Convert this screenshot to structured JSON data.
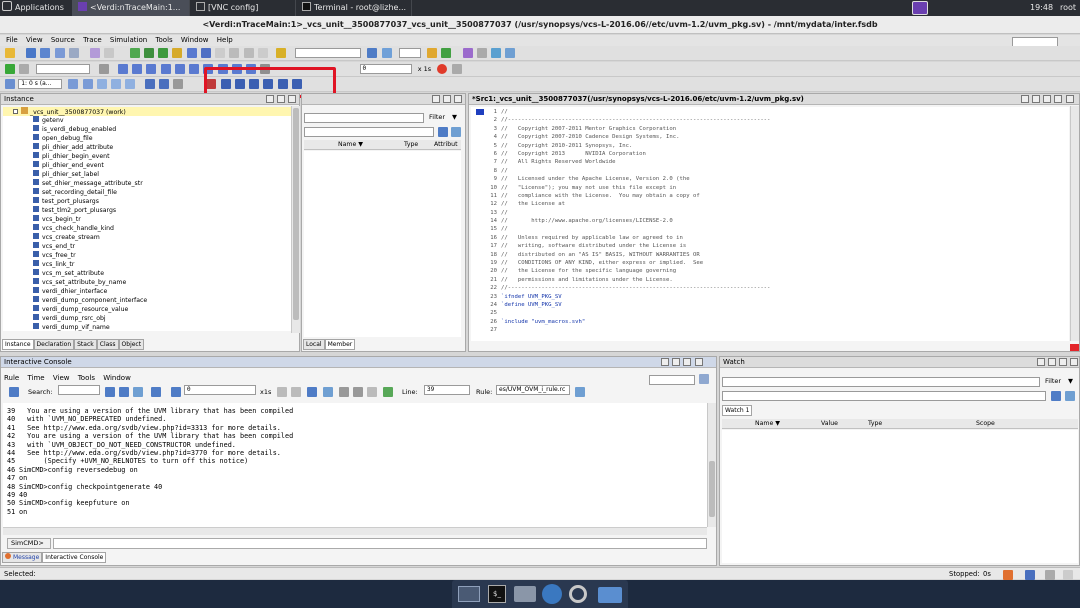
{
  "topbar": {
    "applications": "Applications",
    "tasks": [
      "<Verdi:nTraceMain:1...",
      "[VNC config]",
      "Terminal - root@lizhe..."
    ],
    "clock": "19:48",
    "user": "root"
  },
  "window": {
    "title": "<Verdi:nTraceMain:1>_vcs_unit__3500877037_vcs_unit__3500877037 (/usr/synopsys/vcs-L-2016.06//etc/uvm-1.2/uvm_pkg.sv) - /mnt/mydata/inter.fsdb"
  },
  "menu": [
    "File",
    "View",
    "Source",
    "Trace",
    "Simulation",
    "Tools",
    "Window",
    "Help"
  ],
  "toolbar2": {
    "time_value": "0",
    "time_unit": "x 1s"
  },
  "toolbar3": {
    "time_select": "1: 0 s (a..."
  },
  "instance_panel": {
    "title": "Instance",
    "root": "_vcs_unit__3500877037 (work)",
    "items": [
      "getenv",
      "is_verdi_debug_enabled",
      "open_debug_file",
      "pli_dhier_add_attribute",
      "pli_dhier_begin_event",
      "pli_dhier_end_event",
      "pli_dhier_set_label",
      "set_dhier_message_attribute_str",
      "set_recording_detail_file",
      "test_port_plusargs",
      "test_tlm2_port_plusargs",
      "vcs_begin_tr",
      "vcs_check_handle_kind",
      "vcs_create_stream",
      "vcs_end_tr",
      "vcs_free_tr",
      "vcs_link_tr",
      "vcs_m_set_attribute",
      "vcs_set_attribute_by_name",
      "verdi_dhier_interface",
      "verdi_dump_component_interface",
      "verdi_dump_resource_value",
      "verdi_dump_rsrc_obj",
      "verdi_dump_vif_name"
    ],
    "tabs": [
      "Instance",
      "Declaration",
      "Stack",
      "Class",
      "Object"
    ]
  },
  "member_panel": {
    "filter_label": "Filter",
    "columns": [
      "Name",
      "Type",
      "Attribut"
    ],
    "tabs": [
      "Local",
      "Member"
    ]
  },
  "source_panel": {
    "title": "*Src1:_vcs_unit__3500877037(/usr/synopsys/vcs-L-2016.06/etc/uvm-1.2/uvm_pkg.sv)",
    "lines": [
      {
        "n": "1",
        "t": "//"
      },
      {
        "n": "2",
        "t": "//------------------------------------------------------------------------------"
      },
      {
        "n": "3",
        "t": "//   Copyright 2007-2011 Mentor Graphics Corporation"
      },
      {
        "n": "4",
        "t": "//   Copyright 2007-2010 Cadence Design Systems, Inc."
      },
      {
        "n": "5",
        "t": "//   Copyright 2010-2011 Synopsys, Inc."
      },
      {
        "n": "6",
        "t": "//   Copyright 2013      NVIDIA Corporation"
      },
      {
        "n": "7",
        "t": "//   All Rights Reserved Worldwide"
      },
      {
        "n": "8",
        "t": "//"
      },
      {
        "n": "9",
        "t": "//   Licensed under the Apache License, Version 2.0 (the"
      },
      {
        "n": "10",
        "t": "//   \"License\"); you may not use this file except in"
      },
      {
        "n": "11",
        "t": "//   compliance with the License.  You may obtain a copy of"
      },
      {
        "n": "12",
        "t": "//   the License at"
      },
      {
        "n": "13",
        "t": "//"
      },
      {
        "n": "14",
        "t": "//       http://www.apache.org/licenses/LICENSE-2.0"
      },
      {
        "n": "15",
        "t": "//"
      },
      {
        "n": "16",
        "t": "//   Unless required by applicable law or agreed to in"
      },
      {
        "n": "17",
        "t": "//   writing, software distributed under the License is"
      },
      {
        "n": "18",
        "t": "//   distributed on an \"AS IS\" BASIS, WITHOUT WARRANTIES OR"
      },
      {
        "n": "19",
        "t": "//   CONDITIONS OF ANY KIND, either express or implied.  See"
      },
      {
        "n": "20",
        "t": "//   the License for the specific language governing"
      },
      {
        "n": "21",
        "t": "//   permissions and limitations under the License."
      },
      {
        "n": "22",
        "t": "//------------------------------------------------------------------------------"
      },
      {
        "n": "23",
        "t": "`ifndef UVM_PKG_SV"
      },
      {
        "n": "24",
        "t": "`define UVM_PKG_SV"
      },
      {
        "n": "25",
        "t": ""
      },
      {
        "n": "26",
        "t": "`include \"uvm_macros.svh\""
      },
      {
        "n": "27",
        "t": ""
      }
    ]
  },
  "console": {
    "title": "Interactive Console",
    "menu": [
      "Rule",
      "Time",
      "View",
      "Tools",
      "Window"
    ],
    "search_label": "Search:",
    "time_value": "0",
    "time_unit": "x1s",
    "line_label": "Line:",
    "line_value": "39",
    "rule_label": "Rule:",
    "rule_value": "es/UVM_OVM_i_rule.rc",
    "lines": [
      {
        "n": "39",
        "t": "  You are using a version of the UVM library that has been compiled"
      },
      {
        "n": "40",
        "t": "  with `UVM_NO_DEPRECATED undefined."
      },
      {
        "n": "41",
        "t": "  See http://www.eda.org/svdb/view.php?id=3313 for more details."
      },
      {
        "n": "42",
        "t": "  You are using a version of the UVM library that has been compiled"
      },
      {
        "n": "43",
        "t": "  with `UVM_OBJECT_DO_NOT_NEED_CONSTRUCTOR undefined."
      },
      {
        "n": "44",
        "t": "  See http://www.eda.org/svdb/view.php?id=3770 for more details."
      },
      {
        "n": "45",
        "t": "      (Specify +UVM_NO_RELNOTES to turn off this notice)"
      },
      {
        "n": "46",
        "t": "SimCMD>config reversedebug on"
      },
      {
        "n": "47",
        "t": "on"
      },
      {
        "n": "48",
        "t": "SimCMD>config checkpointgenerate 40"
      },
      {
        "n": "49",
        "t": "40"
      },
      {
        "n": "50",
        "t": "SimCMD>config keepfuture on"
      },
      {
        "n": "51",
        "t": "on"
      }
    ],
    "prompt": "SimCMD>",
    "tabs": [
      "Message",
      "Interactive Console"
    ]
  },
  "watch": {
    "title": "Watch",
    "filter_label": "Filter",
    "tab": "Watch 1",
    "columns": [
      "Name",
      "Value",
      "Type",
      "Scope"
    ]
  },
  "status": {
    "left": "Selected:",
    "stopped": "Stopped:",
    "stopped_value": "0s"
  },
  "colors": {
    "highlight": "#e01424",
    "taskbar": "#1d2a3f"
  }
}
